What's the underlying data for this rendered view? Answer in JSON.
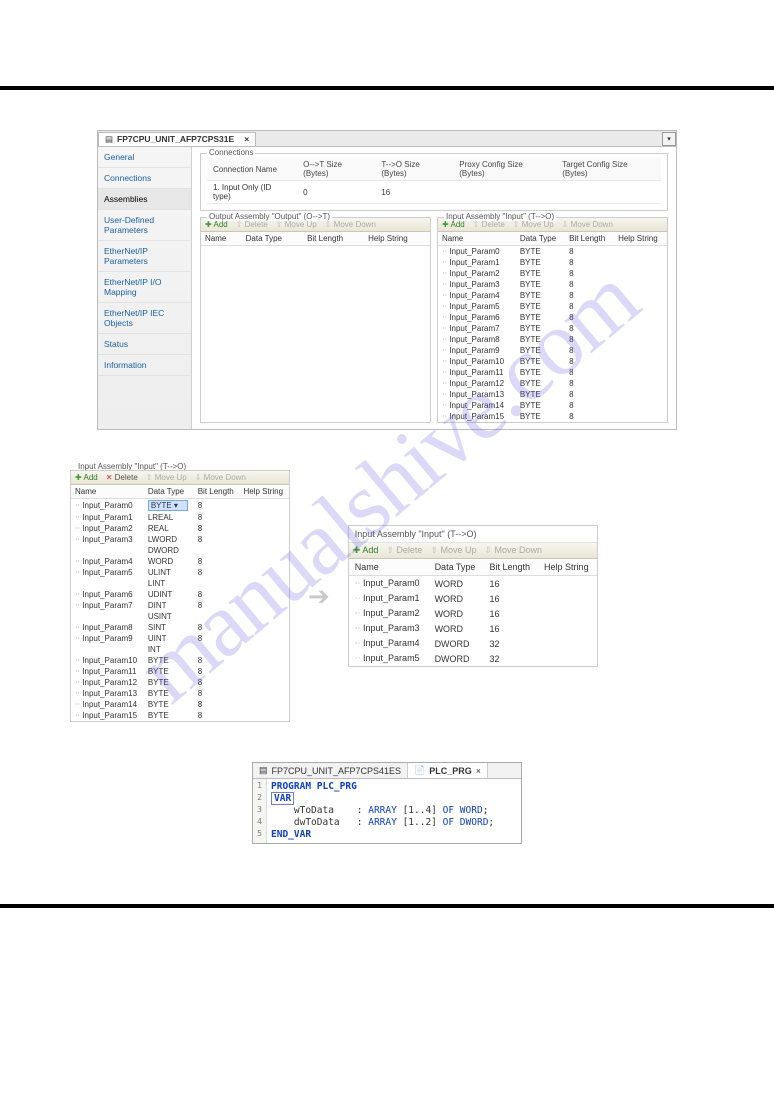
{
  "watermark": "manualshive.com",
  "p1": {
    "tab_title": "FP7CPU_UNIT_AFP7CPS31E",
    "nav": [
      "General",
      "Connections",
      "Assemblies",
      "User-Defined Parameters",
      "EtherNet/IP Parameters",
      "EtherNet/IP I/O Mapping",
      "EtherNet/IP IEC Objects",
      "Status",
      "Information"
    ],
    "nav_active": 2,
    "connections": {
      "title": "Connections",
      "headers": [
        "Connection Name",
        "O-->T Size (Bytes)",
        "T-->O Size (Bytes)",
        "Proxy Config Size (Bytes)",
        "Target Config Size (Bytes)"
      ],
      "rows": [
        [
          "1. Input Only (ID type)",
          "0",
          "16",
          "",
          ""
        ]
      ]
    },
    "out_assy": {
      "title": "Output Assembly \"Output\" (O-->T)",
      "toolbar": [
        "Add",
        "Delete",
        "Move Up",
        "Move Down"
      ],
      "headers": [
        "Name",
        "Data Type",
        "Bit Length",
        "Help String"
      ],
      "rows": []
    },
    "in_assy": {
      "title": "Input Assembly \"Input\" (T-->O)",
      "toolbar": [
        "Add",
        "Delete",
        "Move Up",
        "Move Down"
      ],
      "headers": [
        "Name",
        "Data Type",
        "Bit Length",
        "Help String"
      ],
      "rows": [
        [
          "Input_Param0",
          "BYTE",
          "8",
          ""
        ],
        [
          "Input_Param1",
          "BYTE",
          "8",
          ""
        ],
        [
          "Input_Param2",
          "BYTE",
          "8",
          ""
        ],
        [
          "Input_Param3",
          "BYTE",
          "8",
          ""
        ],
        [
          "Input_Param4",
          "BYTE",
          "8",
          ""
        ],
        [
          "Input_Param5",
          "BYTE",
          "8",
          ""
        ],
        [
          "Input_Param6",
          "BYTE",
          "8",
          ""
        ],
        [
          "Input_Param7",
          "BYTE",
          "8",
          ""
        ],
        [
          "Input_Param8",
          "BYTE",
          "8",
          ""
        ],
        [
          "Input_Param9",
          "BYTE",
          "8",
          ""
        ],
        [
          "Input_Param10",
          "BYTE",
          "8",
          ""
        ],
        [
          "Input_Param11",
          "BYTE",
          "8",
          ""
        ],
        [
          "Input_Param12",
          "BYTE",
          "8",
          ""
        ],
        [
          "Input_Param13",
          "BYTE",
          "8",
          ""
        ],
        [
          "Input_Param14",
          "BYTE",
          "8",
          ""
        ],
        [
          "Input_Param15",
          "BYTE",
          "8",
          ""
        ]
      ]
    }
  },
  "p2": {
    "left": {
      "title": "Input Assembly \"Input\" (T-->O)",
      "toolbar": [
        "Add",
        "Delete",
        "Move Up",
        "Move Down"
      ],
      "headers": [
        "Name",
        "Data Type",
        "Bit Length",
        "Help String"
      ],
      "rows": [
        [
          "Input_Param0",
          "BYTE",
          "8",
          ""
        ],
        [
          "Input_Param1",
          "LREAL",
          "8",
          ""
        ],
        [
          "Input_Param2",
          "REAL",
          "8",
          ""
        ],
        [
          "Input_Param3",
          "LWORD",
          "8",
          ""
        ],
        [
          "",
          "DWORD",
          "",
          ""
        ],
        [
          "Input_Param4",
          "WORD",
          "8",
          ""
        ],
        [
          "Input_Param5",
          "ULINT",
          "8",
          ""
        ],
        [
          "",
          "LINT",
          "",
          ""
        ],
        [
          "Input_Param6",
          "UDINT",
          "8",
          ""
        ],
        [
          "Input_Param7",
          "DINT",
          "8",
          ""
        ],
        [
          "",
          "USINT",
          "",
          ""
        ],
        [
          "Input_Param8",
          "SINT",
          "8",
          ""
        ],
        [
          "Input_Param9",
          "UINT",
          "8",
          ""
        ],
        [
          "",
          "INT",
          "",
          ""
        ],
        [
          "Input_Param10",
          "BYTE",
          "8",
          ""
        ],
        [
          "Input_Param11",
          "BYTE",
          "8",
          ""
        ],
        [
          "Input_Param12",
          "BYTE",
          "8",
          ""
        ],
        [
          "Input_Param13",
          "BYTE",
          "8",
          ""
        ],
        [
          "Input_Param14",
          "BYTE",
          "8",
          ""
        ],
        [
          "Input_Param15",
          "BYTE",
          "8",
          ""
        ]
      ],
      "dd_index": 0,
      "dd_options": [
        "LREAL",
        "REAL",
        "LWORD",
        "DWORD",
        "WORD",
        "ULINT",
        "LINT",
        "UDINT",
        "DINT",
        "USINT",
        "SINT",
        "UINT",
        "INT",
        "BYTE"
      ],
      "dd_selected": "WORD"
    },
    "right": {
      "title": "Input Assembly \"Input\" (T-->O)",
      "toolbar": [
        "Add",
        "Delete",
        "Move Up",
        "Move Down"
      ],
      "headers": [
        "Name",
        "Data Type",
        "Bit Length",
        "Help String"
      ],
      "rows": [
        [
          "Input_Param0",
          "WORD",
          "16",
          ""
        ],
        [
          "Input_Param1",
          "WORD",
          "16",
          ""
        ],
        [
          "Input_Param2",
          "WORD",
          "16",
          ""
        ],
        [
          "Input_Param3",
          "WORD",
          "16",
          ""
        ],
        [
          "Input_Param4",
          "DWORD",
          "32",
          ""
        ],
        [
          "Input_Param5",
          "DWORD",
          "32",
          ""
        ]
      ]
    }
  },
  "p3": {
    "tabs": [
      "FP7CPU_UNIT_AFP7CPS41ES",
      "PLC_PRG"
    ],
    "active_tab": 1,
    "lines": [
      {
        "txt": "PROGRAM PLC_PRG",
        "cls": "kw"
      },
      {
        "txt": "VAR",
        "cls": "kw box"
      },
      {
        "txt": "    wToData    : ARRAY [1..4] OF WORD;",
        "cls": ""
      },
      {
        "txt": "    dwToData   : ARRAY [1..2] OF DWORD;",
        "cls": ""
      },
      {
        "txt": "END_VAR",
        "cls": "kw"
      }
    ]
  }
}
